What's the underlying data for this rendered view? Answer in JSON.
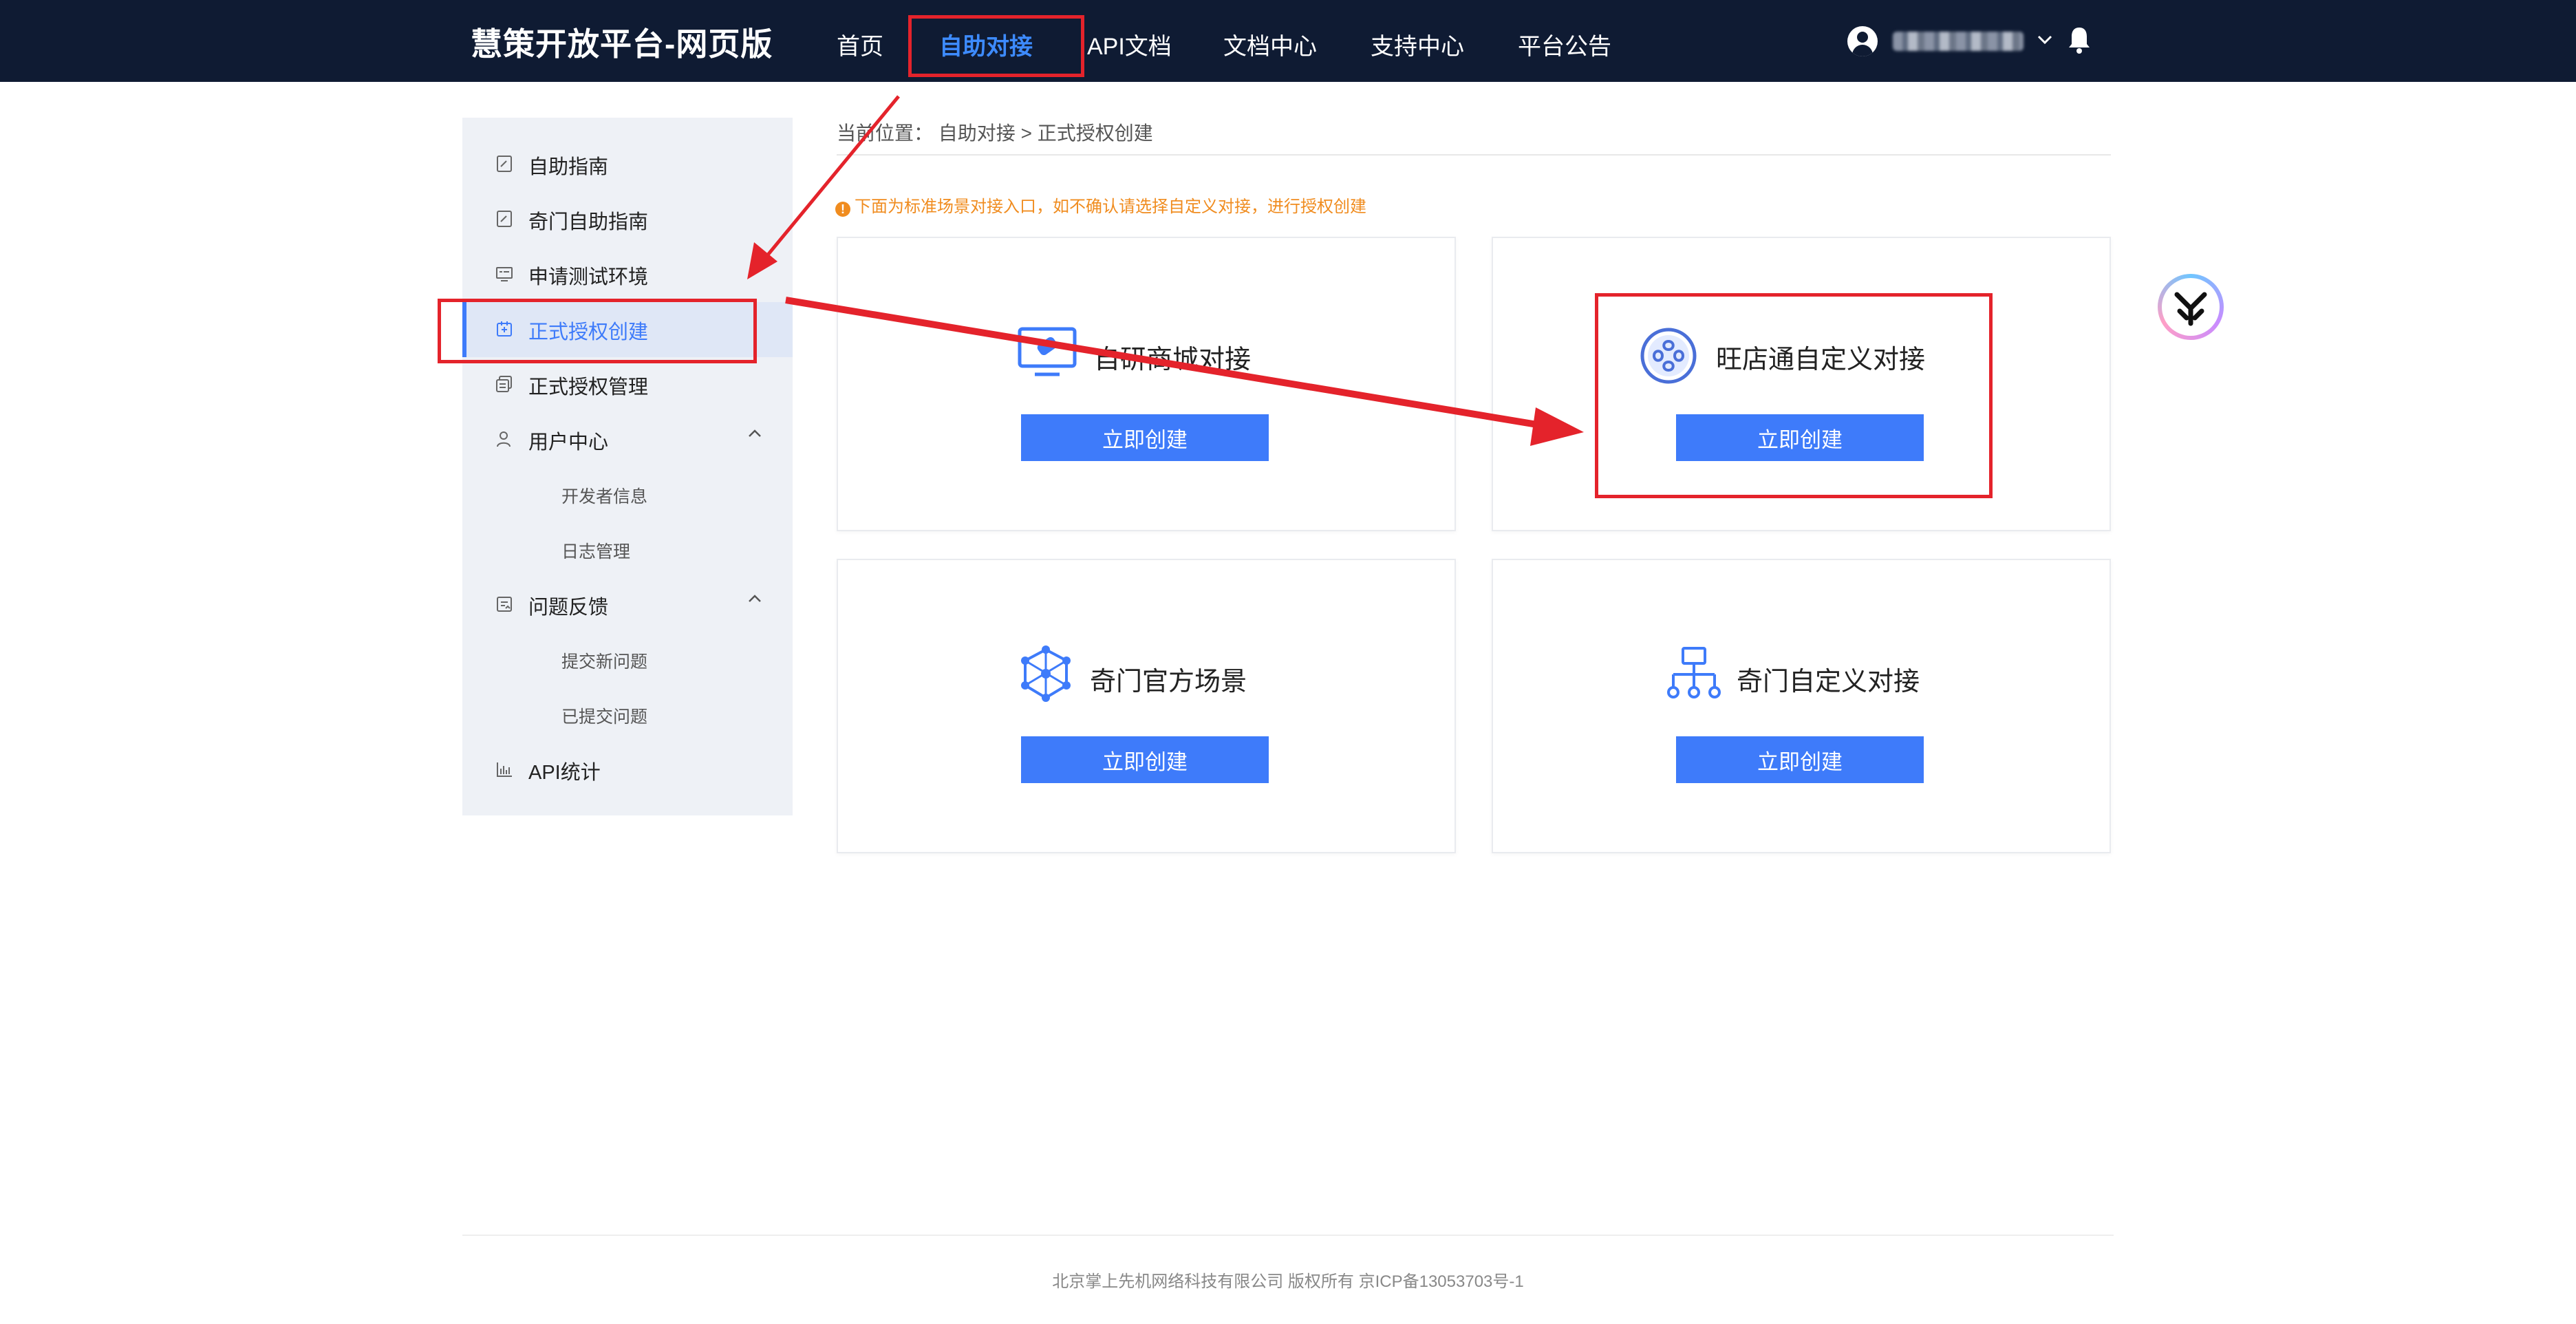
{
  "header": {
    "brand": "慧策开放平台-网页版",
    "nav": [
      {
        "label": "首页"
      },
      {
        "label": "自助对接"
      },
      {
        "label": "API文档"
      },
      {
        "label": "文档中心"
      },
      {
        "label": "支持中心"
      },
      {
        "label": "平台公告"
      }
    ],
    "active_nav": "自助对接",
    "username_blurred": true
  },
  "sidebar": {
    "items": [
      {
        "label": "自助指南",
        "icon": "edit-doc-icon"
      },
      {
        "label": "奇门自助指南",
        "icon": "edit-doc-icon"
      },
      {
        "label": "申请测试环境",
        "icon": "monitor-icon"
      },
      {
        "label": "正式授权创建",
        "icon": "auth-create-icon",
        "active": true
      },
      {
        "label": "正式授权管理",
        "icon": "auth-manage-icon"
      },
      {
        "label": "用户中心",
        "icon": "user-icon",
        "expanded": true
      },
      {
        "label": "开发者信息",
        "sub": true
      },
      {
        "label": "日志管理",
        "sub": true
      },
      {
        "label": "问题反馈",
        "icon": "feedback-icon",
        "expanded": true
      },
      {
        "label": "提交新问题",
        "sub": true
      },
      {
        "label": "已提交问题",
        "sub": true
      },
      {
        "label": "API统计",
        "icon": "bar-chart-icon"
      }
    ]
  },
  "breadcrumb": {
    "prefix": "当前位置：",
    "path": "自助对接 > 正式授权创建"
  },
  "notice": "下面为标准场景对接入口，如不确认请选择自定义对接，进行授权创建",
  "cards": [
    {
      "title": "自研商城对接",
      "button": "立即创建",
      "icon": "mall-link-icon"
    },
    {
      "title": "旺店通自定义对接",
      "button": "立即创建",
      "icon": "wdt-custom-icon"
    },
    {
      "title": "奇门官方场景",
      "button": "立即创建",
      "icon": "network-hex-icon"
    },
    {
      "title": "奇门自定义对接",
      "button": "立即创建",
      "icon": "org-tree-icon"
    }
  ],
  "footer": "北京掌上先机网络科技有限公司 版权所有 京ICP备13053703号-1",
  "colors": {
    "topbar": "#0f1b33",
    "accent": "#3e7bfa",
    "annotation_red": "#e4232b",
    "notice_orange": "#f08c1f"
  }
}
